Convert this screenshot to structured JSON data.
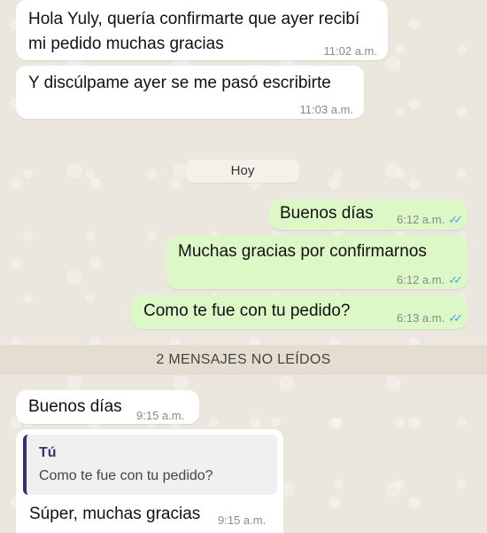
{
  "messages": {
    "m1": {
      "line1": "Hola Yuly, quería confirmarte que ayer recibí",
      "line2": "mi pedido muchas gracias",
      "time": "11:02 a.m."
    },
    "m2": {
      "text": "Y discúlpame ayer se me pasó escribirte",
      "time": "11:03 a.m."
    },
    "m3": {
      "text": "Buenos días",
      "time": "6:12 a.m."
    },
    "m4": {
      "text": "Muchas gracias por confirmarnos",
      "time": "6:12 a.m."
    },
    "m5": {
      "text": "Como te fue con tu pedido?",
      "time": "6:13 a.m."
    },
    "m6": {
      "text": "Buenos días",
      "time": "9:15 a.m."
    },
    "m7": {
      "quote_author": "Tú",
      "quote_text": "Como te fue con tu pedido?",
      "text": "Súper, muchas gracias",
      "time": "9:15 a.m."
    }
  },
  "date_separator": "Hoy",
  "unread_banner": "2 MENSAJES NO LEÍDOS",
  "read_receipt_icon": "double-check-icon",
  "colors": {
    "incoming": "#ffffff",
    "outgoing": "#dcf8c6",
    "read_tick": "#4fa3e0",
    "quote_accent": "#35306f"
  }
}
